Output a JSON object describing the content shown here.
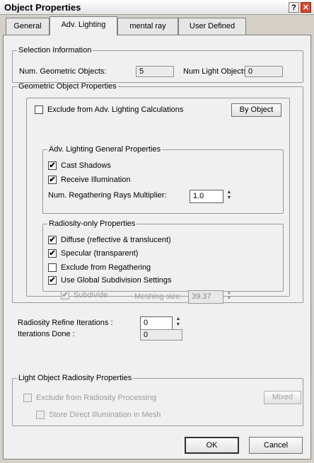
{
  "window": {
    "title": "Object Properties",
    "help": "?",
    "close": "✕"
  },
  "tabs": [
    "General",
    "Adv. Lighting",
    "mental ray",
    "User Defined"
  ],
  "selection": {
    "legend": "Selection Information",
    "geo_label": "Num. Geometric Objects:",
    "geo_value": "5",
    "light_label": "Num Light Objects:",
    "light_value": "0"
  },
  "geometric": {
    "legend": "Geometric Object Properties",
    "exclude_label": "Exclude from Adv. Lighting Calculations",
    "by_object": "By Object",
    "general": {
      "legend": "Adv. Lighting General Properties",
      "cast_shadows": "Cast Shadows",
      "receive_illum": "Receive Illumination",
      "regather_label": "Num. Regathering Rays Multiplier:",
      "regather_value": "1.0"
    },
    "radiosity": {
      "legend": "Radiosity-only Properties",
      "diffuse": "Diffuse (reflective & translucent)",
      "specular": "Specular (transparent)",
      "exclude_regather": "Exclude from Regathering",
      "global_subdiv": "Use Global Subdivision Settings",
      "subdivide": "Subdivide",
      "mesh_label": "Meshing size:",
      "mesh_value": "39.37"
    }
  },
  "refine": {
    "label": "Radiosity Refine Iterations :",
    "value": "0",
    "done_label": "Iterations Done :",
    "done_value": "0"
  },
  "light": {
    "legend": "Light Object Radiosity Properties",
    "exclude": "Exclude from Radiosity Processing",
    "mixed": "Mixed",
    "store": "Store Direct Illumination in Mesh"
  },
  "buttons": {
    "ok": "OK",
    "cancel": "Cancel"
  },
  "glyphs": {
    "check": "✔",
    "spin_up": "▲",
    "spin_down": "▼"
  }
}
